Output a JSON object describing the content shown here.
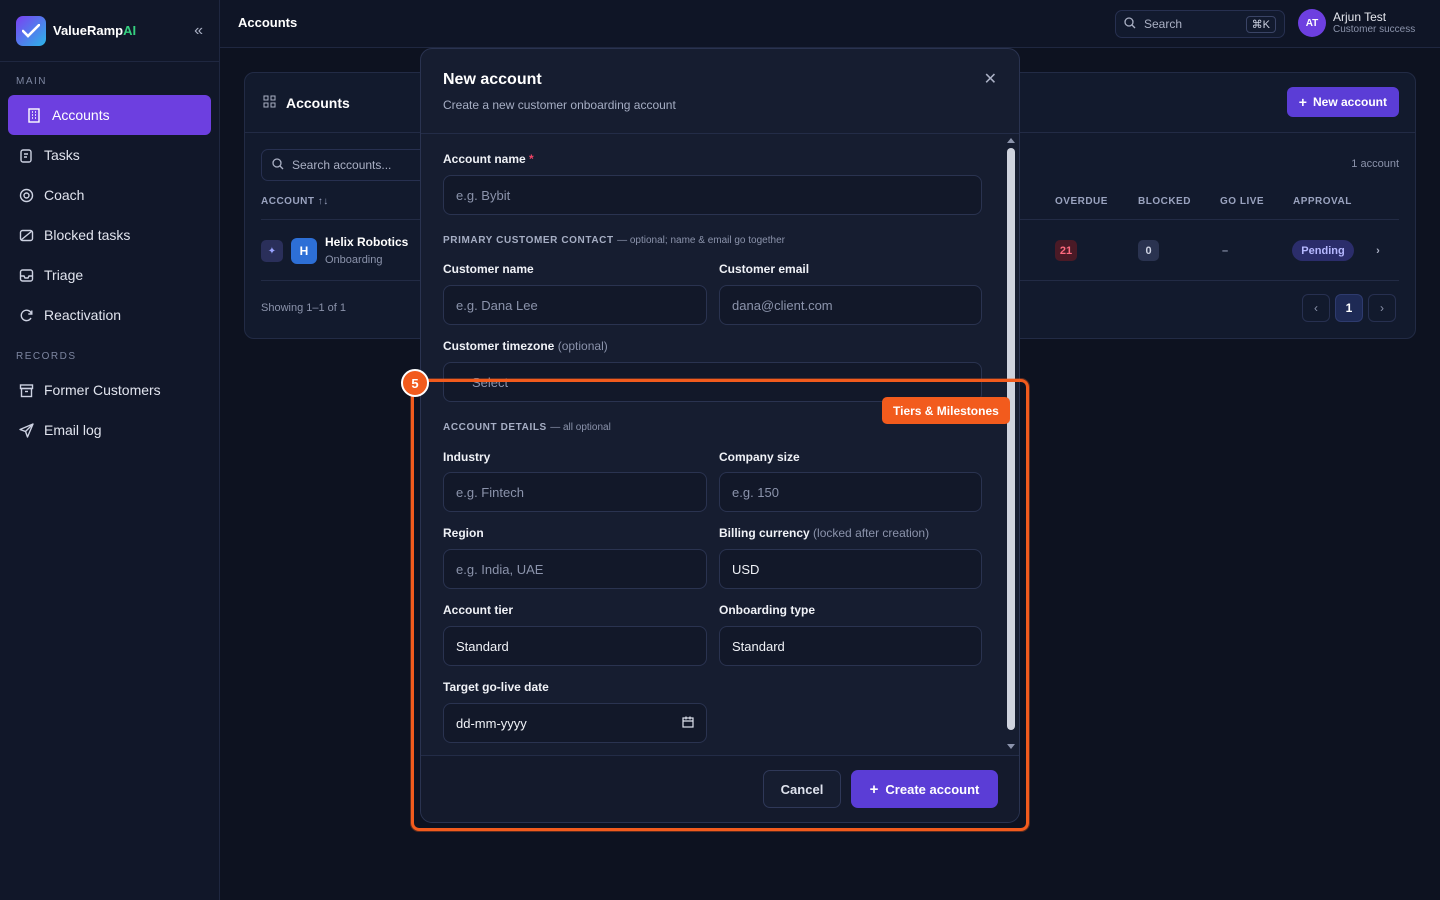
{
  "brand": {
    "name": "ValueRamp",
    "name_ai": "AI"
  },
  "sidebar": {
    "main_label": "MAIN",
    "records_label": "RECORDS",
    "main_items": [
      {
        "label": "Accounts",
        "icon": "building-icon"
      },
      {
        "label": "Tasks",
        "icon": "clipboard-icon"
      },
      {
        "label": "Coach",
        "icon": "target-icon"
      },
      {
        "label": "Blocked tasks",
        "icon": "blocked-icon"
      },
      {
        "label": "Triage",
        "icon": "inbox-icon"
      },
      {
        "label": "Reactivation",
        "icon": "refresh-icon"
      }
    ],
    "record_items": [
      {
        "label": "Former Customers",
        "icon": "archive-icon"
      },
      {
        "label": "Email log",
        "icon": "send-icon"
      }
    ]
  },
  "topbar": {
    "title": "Accounts",
    "search_label": "Search",
    "shortcut": "⌘K",
    "user": {
      "initials": "AT",
      "name": "Arjun Test",
      "role": "Customer success"
    }
  },
  "accounts_card": {
    "title": "Accounts",
    "new_button": "New account",
    "search_placeholder": "Search accounts...",
    "count": "1 account",
    "columns": [
      "ACCOUNT",
      "OVERDUE",
      "BLOCKED",
      "GO LIVE",
      "APPROVAL"
    ],
    "row": {
      "initial": "H",
      "name": "Helix Robotics",
      "stage": "Onboarding",
      "overdue": "21",
      "blocked": "0",
      "go_live": "–",
      "approval": "Pending"
    },
    "showing": "Showing 1–1 of 1",
    "page": "1"
  },
  "modal": {
    "title": "New account",
    "subtitle": "Create a new customer onboarding account",
    "account_name_label": "Account name",
    "account_name_placeholder": "e.g. Bybit",
    "contact_section": "PRIMARY CUSTOMER CONTACT",
    "contact_note": "— optional; name & email go together",
    "customer_name_label": "Customer name",
    "customer_name_placeholder": "e.g. Dana Lee",
    "customer_email_label": "Customer email",
    "customer_email_placeholder": "dana@client.com",
    "timezone_label": "Customer timezone",
    "timezone_optional": "(optional)",
    "timezone_value": "Select",
    "details_section": "ACCOUNT DETAILS",
    "details_note": "— all optional",
    "industry_label": "Industry",
    "industry_placeholder": "e.g. Fintech",
    "company_size_label": "Company size",
    "company_size_placeholder": "e.g. 150",
    "region_label": "Region",
    "region_placeholder": "e.g. India, UAE",
    "currency_label": "Billing currency",
    "currency_note": "(locked after creation)",
    "currency_value": "USD",
    "tier_label": "Account tier",
    "tier_value": "Standard",
    "onboarding_label": "Onboarding type",
    "onboarding_value": "Standard",
    "golive_label": "Target go-live date",
    "golive_placeholder": "dd-mm-yyyy",
    "cancel": "Cancel",
    "create": "Create account"
  },
  "overlay": {
    "step": "5",
    "tag": "Tiers & Milestones"
  }
}
